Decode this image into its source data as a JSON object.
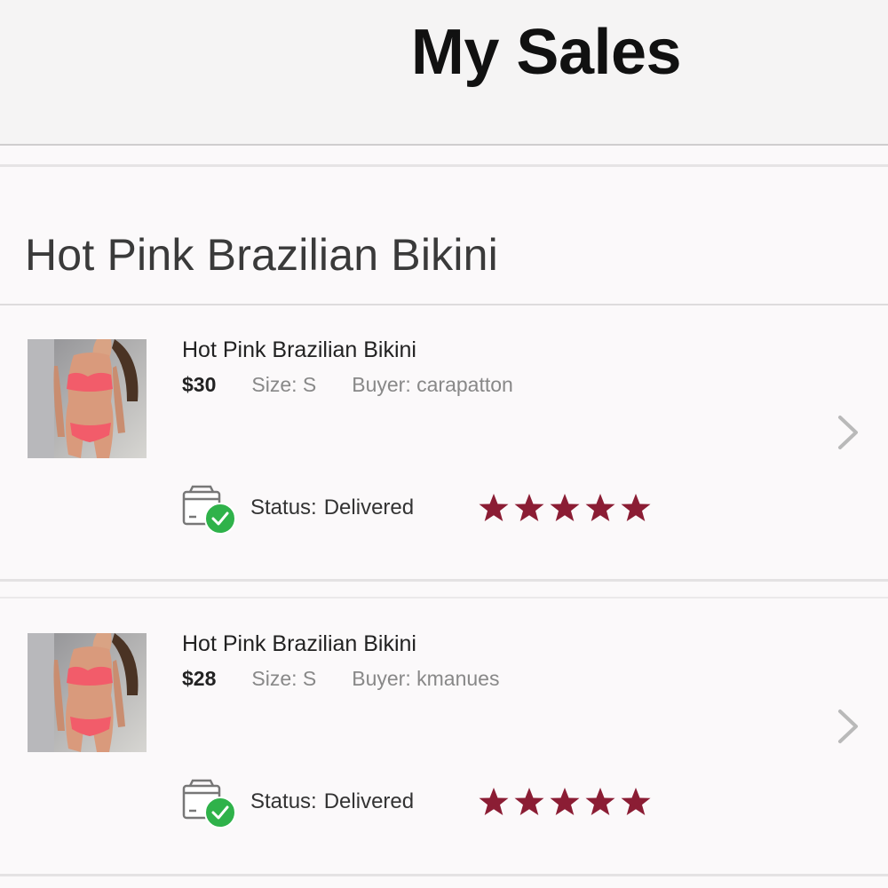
{
  "header": {
    "title": "My Sales"
  },
  "section": {
    "title": "Hot Pink Brazilian Bikini"
  },
  "sales": [
    {
      "title": "Hot Pink Brazilian Bikini",
      "price": "$30",
      "size": "Size: S",
      "buyer": "Buyer: carapatton",
      "status_label": "Status:",
      "status_value": "Delivered",
      "rating": 5
    },
    {
      "title": "Hot Pink Brazilian Bikini",
      "price": "$28",
      "size": "Size: S",
      "buyer": "Buyer: kmanues",
      "status_label": "Status:",
      "status_value": "Delivered",
      "rating": 5
    }
  ],
  "icons": {
    "delivered": "box-check-icon",
    "navigate": "chevron-right-icon",
    "rating": "star-icon"
  },
  "colors": {
    "star": "#8b1d34",
    "check_badge": "#2fb24a",
    "chevron": "#b9b9b9"
  }
}
